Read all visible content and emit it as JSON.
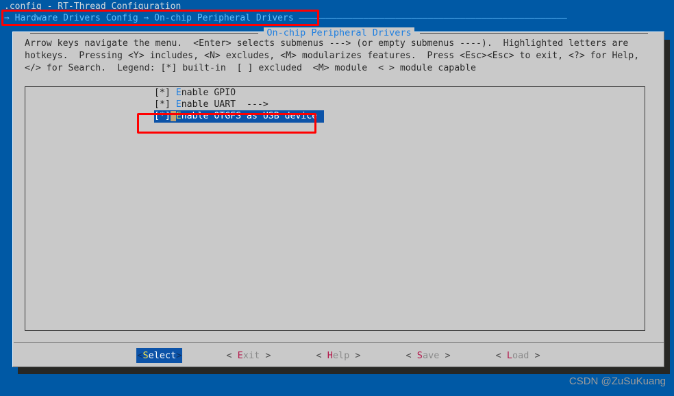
{
  "terminal": {
    "title": ".config - RT-Thread Configuration",
    "breadcrumb": "⇒ Hardware Drivers Config ⇒ On-chip Peripheral Drivers ——————————————————————————————————————————————————"
  },
  "dialog": {
    "title": "On-chip Peripheral Drivers",
    "help_text": "Arrow keys navigate the menu.  <Enter> selects submenus ---> (or empty submenus ----).  Highlighted letters are hotkeys.  Pressing <Y> includes, <N> excludes, <M> modularizes features.  Press <Esc><Esc> to exit, <?> for Help, </> for Search.  Legend: [*] built-in  [ ] excluded  <M> module  < > module capable"
  },
  "menu": {
    "items": [
      {
        "tag": "[*] ",
        "hotkey": "E",
        "label": "nable GPIO",
        "arrow": "",
        "selected": false
      },
      {
        "tag": "[*] ",
        "hotkey": "E",
        "label": "nable UART",
        "arrow": "  --->",
        "selected": false
      },
      {
        "tag": "[*]",
        "cursor": " ",
        "hotkey": "E",
        "label": "nable OTGFS as USB device",
        "arrow": "",
        "selected": true
      }
    ]
  },
  "buttons": [
    {
      "left": "<",
      "key": "S",
      "text": "elect",
      "right": ">",
      "active": true,
      "name": "select"
    },
    {
      "left": "< ",
      "key": "E",
      "text": "xit",
      "right": " >",
      "active": false,
      "name": "exit"
    },
    {
      "left": "< ",
      "key": "H",
      "text": "elp",
      "right": " >",
      "active": false,
      "name": "help"
    },
    {
      "left": "< ",
      "key": "S",
      "text": "ave",
      "right": " >",
      "active": false,
      "name": "save"
    },
    {
      "left": "< ",
      "key": "L",
      "text": "oad",
      "right": " >",
      "active": false,
      "name": "load"
    }
  ],
  "watermark": "CSDN @ZuSuKuang",
  "colors": {
    "terminal_background": "#0059a5",
    "dialog_background": "#c9c9c9",
    "highlight_background": "#0c53a8",
    "hotkey": "#1f7fe0",
    "annotation_red": "#ff0000",
    "cursor_block": "#c2a372"
  }
}
